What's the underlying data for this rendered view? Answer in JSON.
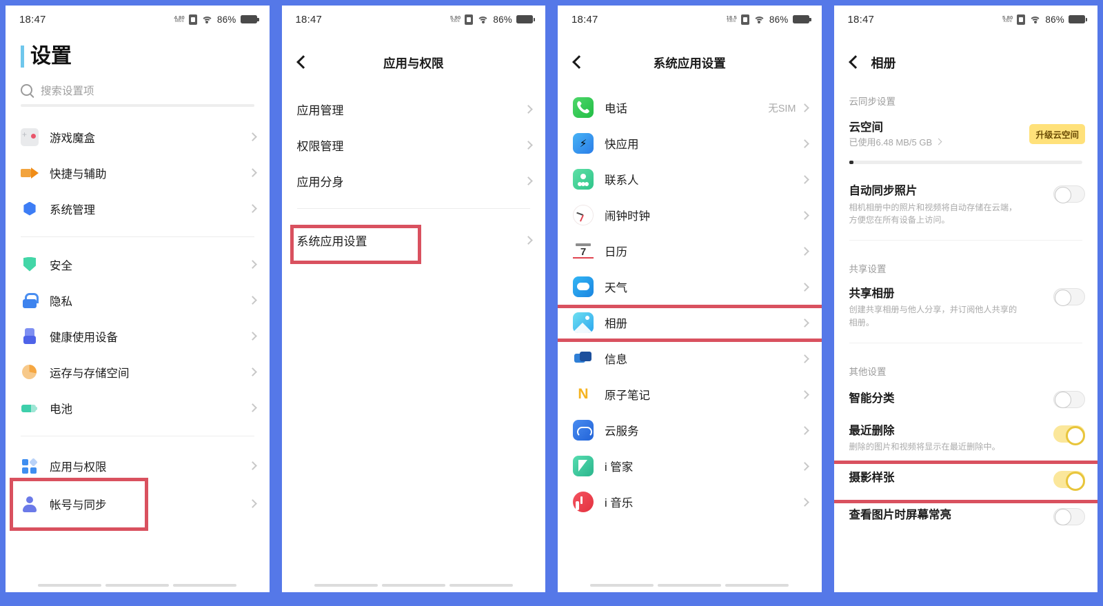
{
  "statusbar": {
    "time": "18:47",
    "speeds": [
      "4.80",
      "5.90",
      "18.5",
      "5.80"
    ],
    "speed_unit": "MB/s",
    "speed_unit_kb": "KB/s",
    "battery": "86%"
  },
  "panel1": {
    "title": "设置",
    "search_placeholder": "搜索设置项",
    "group1": [
      {
        "label": "游戏魔盒",
        "icon": "game-box-icon",
        "cls": "i-game"
      },
      {
        "label": "快捷与辅助",
        "icon": "shortcut-accessibility-icon",
        "cls": "i-quickasst"
      },
      {
        "label": "系统管理",
        "icon": "system-management-icon",
        "cls": "i-sysmgr"
      }
    ],
    "group2": [
      {
        "label": "安全",
        "icon": "shield-icon",
        "cls": "i-safe"
      },
      {
        "label": "隐私",
        "icon": "lock-icon",
        "cls": "i-privacy"
      },
      {
        "label": "健康使用设备",
        "icon": "digital-wellbeing-icon",
        "cls": "i-health"
      },
      {
        "label": "运存与存储空间",
        "icon": "storage-icon",
        "cls": "i-storage"
      },
      {
        "label": "电池",
        "icon": "battery-icon",
        "cls": "i-batt"
      }
    ],
    "group3": [
      {
        "label": "应用与权限",
        "icon": "apps-permissions-icon",
        "cls": "i-apps",
        "highlight": true
      },
      {
        "label": "帐号与同步",
        "icon": "account-sync-icon",
        "cls": "i-account"
      }
    ]
  },
  "panel2": {
    "title": "应用与权限",
    "group1": [
      {
        "label": "应用管理"
      },
      {
        "label": "权限管理"
      },
      {
        "label": "应用分身"
      }
    ],
    "group2": [
      {
        "label": "系统应用设置",
        "highlight": true
      }
    ]
  },
  "panel3": {
    "title": "系统应用设置",
    "apps": [
      {
        "label": "电话",
        "value": "无SIM",
        "icon": "phone-app-icon",
        "cls": "ic-phone"
      },
      {
        "label": "快应用",
        "value": "",
        "icon": "quick-app-icon",
        "cls": "ic-quick"
      },
      {
        "label": "联系人",
        "value": "",
        "icon": "contacts-app-icon",
        "cls": "ic-contacts"
      },
      {
        "label": "闹钟时钟",
        "value": "",
        "icon": "clock-app-icon",
        "cls": "ic-clock"
      },
      {
        "label": "日历",
        "value": "",
        "icon": "calendar-app-icon",
        "cls": "ic-cal"
      },
      {
        "label": "天气",
        "value": "",
        "icon": "weather-app-icon",
        "cls": "ic-weather"
      },
      {
        "label": "相册",
        "value": "",
        "icon": "album-app-icon",
        "cls": "ic-album",
        "highlight": true
      },
      {
        "label": "信息",
        "value": "",
        "icon": "messages-app-icon",
        "cls": "ic-msg"
      },
      {
        "label": "原子笔记",
        "value": "",
        "icon": "notes-app-icon",
        "cls": "ic-note"
      },
      {
        "label": "云服务",
        "value": "",
        "icon": "cloud-service-icon",
        "cls": "ic-cloudsvc"
      },
      {
        "label": "i 管家",
        "value": "",
        "icon": "imanager-app-icon",
        "cls": "ic-mgr"
      },
      {
        "label": "i 音乐",
        "value": "",
        "icon": "imusic-app-icon",
        "cls": "ic-music"
      }
    ]
  },
  "panel4": {
    "title": "相册",
    "section_cloud": "云同步设置",
    "cloud_space": {
      "title": "云空间",
      "usage": "已使用6.48 MB/5 GB",
      "badge": "升级云空间"
    },
    "auto_sync": {
      "title": "自动同步照片",
      "desc": "相机相册中的照片和视频将自动存储在云端，方便您在所有设备上访问。",
      "state": "off"
    },
    "section_share": "共享设置",
    "shared_album": {
      "title": "共享相册",
      "desc": "创建共享相册与他人分享，并订阅他人共享的相册。",
      "state": "off"
    },
    "section_other": "其他设置",
    "other_items": [
      {
        "title": "智能分类",
        "desc": "",
        "state": "off",
        "highlight": false
      },
      {
        "title": "最近删除",
        "desc": "删除的图片和视频将显示在最近删除中。",
        "state": "on",
        "highlight": true
      },
      {
        "title": "摄影样张",
        "desc": "",
        "state": "on",
        "highlight": false
      },
      {
        "title": "查看图片时屏幕常亮",
        "desc": "",
        "state": "off",
        "highlight": false
      }
    ]
  },
  "colors": {
    "background": "#5578e8",
    "highlight": "#d9515f",
    "accent_title_bar": "#6fc7ec",
    "toggle_on": "#fbe79b",
    "badge": "#ffe17a"
  }
}
